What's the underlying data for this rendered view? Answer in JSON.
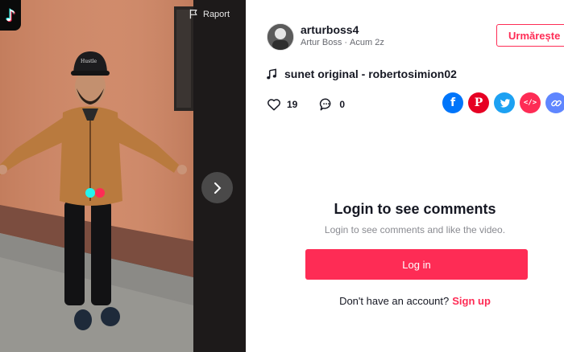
{
  "video": {
    "report_label": "Raport",
    "logo_icon": "tiktok-logo-icon",
    "cap_text": "Hustle"
  },
  "author": {
    "username": "arturboss4",
    "display_name": "Artur Boss",
    "time_ago": "Acum 2z",
    "follow_label": "Urmărește"
  },
  "sound": {
    "label": "sunet original - robertosimion02"
  },
  "stats": {
    "likes": "19",
    "comments": "0"
  },
  "share": {
    "icons": [
      "facebook-icon",
      "pinterest-icon",
      "twitter-icon",
      "embed-icon",
      "link-icon"
    ],
    "embed_text": "</>"
  },
  "login": {
    "title": "Login to see comments",
    "subtitle": "Login to see comments and like the video.",
    "button_label": "Log in",
    "signup_prompt": "Don't have an account?",
    "signup_link": "Sign up"
  },
  "colors": {
    "accent": "#fe2c55",
    "facebook": "#0075fa",
    "pinterest": "#e60023",
    "twitter": "#1da1f2",
    "link": "#5f86ff"
  }
}
